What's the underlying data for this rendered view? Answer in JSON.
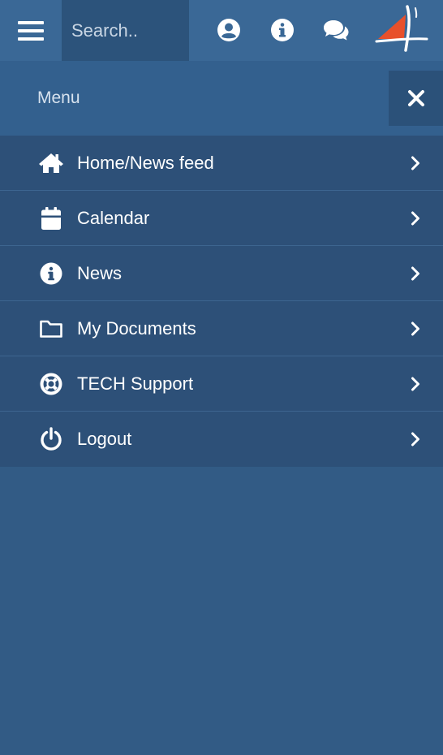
{
  "topbar": {
    "menu_icon": "hamburger-icon",
    "search": {
      "placeholder": "Search..",
      "value": ""
    },
    "icons": [
      "user-icon",
      "info-icon",
      "chat-icon"
    ],
    "logo_icon": "sail-logo-icon"
  },
  "menu": {
    "title": "Menu",
    "close_icon": "close-icon",
    "items": [
      {
        "label": "Home/News feed",
        "icon": "home-icon"
      },
      {
        "label": "Calendar",
        "icon": "calendar-icon"
      },
      {
        "label": "News",
        "icon": "info-icon"
      },
      {
        "label": "My Documents",
        "icon": "folder-icon"
      },
      {
        "label": "TECH Support",
        "icon": "life-ring-icon"
      },
      {
        "label": "Logout",
        "icon": "power-icon"
      }
    ]
  },
  "colors": {
    "background": "#325b85",
    "topbar": "#3a6896",
    "search_bg": "#2c537b",
    "menu_header": "#33608e",
    "menu_item": "#2d5078",
    "logo_accent": "#e8502b"
  }
}
